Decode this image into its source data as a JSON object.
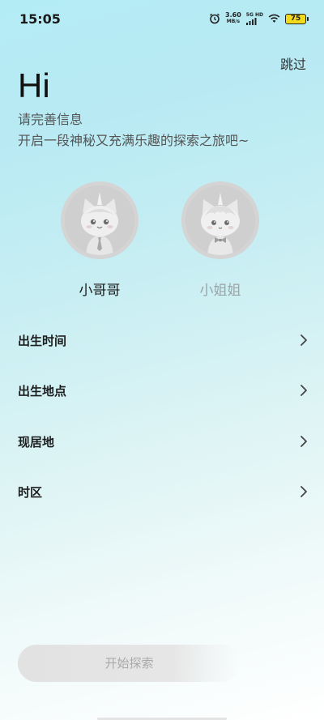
{
  "status_bar": {
    "time": "15:05",
    "net_speed_value": "3.60",
    "net_speed_unit": "MB/s",
    "signal_label": "5G HD",
    "battery_level": "75",
    "icons": [
      "alarm-icon",
      "signal-icon",
      "wifi-icon",
      "battery-icon"
    ]
  },
  "header": {
    "skip_label": "跳过",
    "greeting": "Hi",
    "subtitle": "请完善信息",
    "subtitle2": "开启一段神秘又充满乐趣的探索之旅吧~"
  },
  "gender": {
    "options": [
      {
        "label": "小哥哥",
        "icon": "boy-avatar-icon",
        "selected": true
      },
      {
        "label": "小姐姐",
        "icon": "girl-avatar-icon",
        "selected": false
      }
    ]
  },
  "form": {
    "rows": [
      {
        "label": "出生时间",
        "icon": "chevron-right-icon"
      },
      {
        "label": "出生地点",
        "icon": "chevron-right-icon"
      },
      {
        "label": "现居地",
        "icon": "chevron-right-icon"
      },
      {
        "label": "时区",
        "icon": "chevron-right-icon"
      }
    ]
  },
  "footer": {
    "start_label": "开始探索"
  },
  "colors": {
    "background_top": "#b4ecf6",
    "background_bottom": "#ffffff",
    "disabled_button": "#e2e2e2",
    "battery": "#f2d91c"
  }
}
